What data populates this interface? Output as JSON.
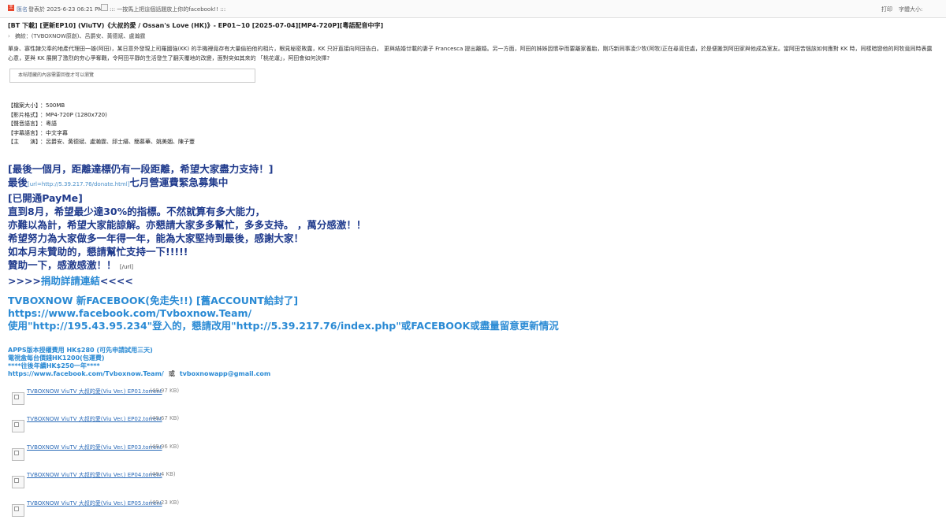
{
  "topbar": {
    "badge_letter": "王",
    "author": "匯名",
    "posted": "發表於 2025-6-23 06:21 PM",
    "banner_alt": "::: 一按馬上把這個話題放上你的facebook!! :::",
    "print": "打印",
    "font_size": "字體大小:"
  },
  "post": {
    "title": "[BT 下載] [更新EP10] (ViuTV)《大叔的愛 / Ossan's Love (HK)》- EP01~10 [2025-07-04][MP4-720P][粵語配音中字]",
    "tags_prefix": "›",
    "tags": "搞絞：(TVBOXNOW原創)、呂爵安、黃德斌、盧瀚霆",
    "synopsis": "單身、寡性隸欠奉的地產代理田一雄(阿田)，某日意外發現上司羅國強(KK) 的手機裡竟存有大量偷拍他的相片，眼見秘密敗露，KK 只好直接向阿田告白。 更與結婚廿載的妻子 Francesca 提出離婚。另一方面，阿田的姊姊因懷孕而要離家養胎，剛巧新同事凌少牧(阿牧)正在尋覓住處，於是便搬到阿田家與他成為室友。當阿田苦惱該如何應對 KK 時，同樣暗戀他的阿牧竟同時表露心意，更與 KK 展開了激烈的夯心爭奪戰，令阿田平靜的生活發生了翻天覆地的改變，面對突如其來的 「桃花運」，阿田會如何決擇?",
    "hidden_notice": "本帖隱藏的內容需要回復才可以瀏覽"
  },
  "info": [
    {
      "label": "【檔案大小】",
      "value": "：500MB"
    },
    {
      "label": "【影片格式】",
      "value": "：MP4-720P (1280x720)"
    },
    {
      "label": "【聲音語言】",
      "value": "：粵語"
    },
    {
      "label": "【字幕語言】",
      "value": "：中文字幕"
    },
    {
      "label": "【主　　演】",
      "value": "：呂爵安、黃德斌、盧瀚霆、邱士縉、簡慕華、姚美姻、陳子豐"
    }
  ],
  "donation": {
    "line1": "[最後一個月，距離達標仍有一段距離，希望大家盡力支持！]",
    "line2_prefix": "最後",
    "line2_url": "[url=http://5.39.217.76/donate.html]",
    "line2_suffix": "七月營運費緊急募集中",
    "line3": "[已開通PayMe]",
    "line4": "直到8月，希望最少達30%的指標。不然就算有多大能力，",
    "line5": "亦難以為計，希望大家能諒解。亦懇請大家多多幫忙，多多支持。 ，萬分感激！！",
    "line6": "希望努力為大家做多一年得一年，能為大家堅持到最後，感謝大家！",
    "line7": "如本月未贊助的，懇請幫忙支持一下!!!!!",
    "line8": "贊助一下，感激感激！！",
    "line8_end": "[/url]",
    "line9_prefix": ">>>>",
    "line9_link": "捐助詳請連結",
    "line9_suffix": "<<<<"
  },
  "facebook": {
    "line1": "TVBOXNOW 新FACEBOOK(免走失!!) [舊ACCOUNT給封了]",
    "line2": "https://www.facebook.com/Tvboxnow.Team/",
    "line3": "使用\"http://195.43.95.234\"登入的，懇請改用\"http://5.39.217.76/index.php\"或FACEBOOK或盡量留意更新情況"
  },
  "apps": {
    "line1": "APPS版本授權費用 HK$280 (可先申請試用三天)",
    "line2": "電視盒每台價錢HK1200(包運費)",
    "line3": "****往後年續HK$250一年****",
    "line4_fb": "https://www.facebook.com/Tvboxnow.Team/",
    "line4_or": "或",
    "line4_email": "tvboxnowapp@gmail.com"
  },
  "files": [
    {
      "name": "TVBOXNOW ViuTV 大叔的愛(Viu Ver.) EP01.torrent",
      "size": "(48.97 KB)"
    },
    {
      "name": "TVBOXNOW ViuTV 大叔的愛(Viu Ver.) EP02.torrent",
      "size": "(48.67 KB)"
    },
    {
      "name": "TVBOXNOW ViuTV 大叔的愛(Viu Ver.) EP03.torrent",
      "size": "(48.96 KB)"
    },
    {
      "name": "TVBOXNOW ViuTV 大叔的愛(Viu Ver.) EP04.torrent",
      "size": "(48.4 KB)"
    },
    {
      "name": "TVBOXNOW ViuTV 大叔的愛(Viu Ver.) EP05.torrent",
      "size": "(49.23 KB)"
    }
  ]
}
